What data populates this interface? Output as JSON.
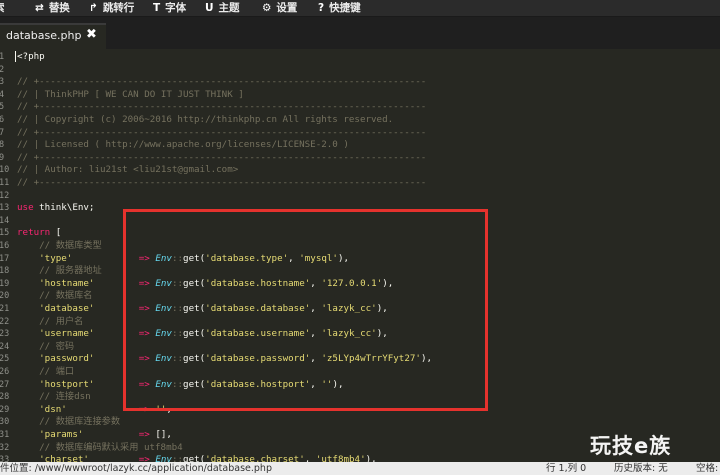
{
  "toolbar": [
    {
      "icon": "search-icon",
      "glyph": "",
      "label": "索"
    },
    {
      "icon": "swap-icon",
      "glyph": "⇄",
      "label": "替换"
    },
    {
      "icon": "goto-line-icon",
      "glyph": "↱",
      "label": "跳转行"
    },
    {
      "icon": "font-icon",
      "glyph": "T",
      "label": "字体"
    },
    {
      "icon": "theme-icon",
      "glyph": "U",
      "label": "主题"
    },
    {
      "icon": "gear-icon",
      "glyph": "⚙",
      "label": "设置"
    },
    {
      "icon": "question-icon",
      "glyph": "?",
      "label": "快捷键"
    }
  ],
  "tab": {
    "label": "database.php",
    "close": "✖"
  },
  "lines": [
    [
      {
        "c": "c-txt",
        "t": "<?php"
      }
    ],
    [],
    [
      {
        "c": "c-cm",
        "t": "// +----------------------------------------------------------------------"
      }
    ],
    [
      {
        "c": "c-cm",
        "t": "// | ThinkPHP [ WE CAN DO IT JUST THINK ]"
      }
    ],
    [
      {
        "c": "c-cm",
        "t": "// +----------------------------------------------------------------------"
      }
    ],
    [
      {
        "c": "c-cm",
        "t": "// | Copyright (c) 2006~2016 http://thinkphp.cn All rights reserved."
      }
    ],
    [
      {
        "c": "c-cm",
        "t": "// +----------------------------------------------------------------------"
      }
    ],
    [
      {
        "c": "c-cm",
        "t": "// | Licensed ( http://www.apache.org/licenses/LICENSE-2.0 )"
      }
    ],
    [
      {
        "c": "c-cm",
        "t": "// +----------------------------------------------------------------------"
      }
    ],
    [
      {
        "c": "c-cm",
        "t": "// | Author: liu21st <liu21st@gmail.com>"
      }
    ],
    [
      {
        "c": "c-cm",
        "t": "// +----------------------------------------------------------------------"
      }
    ],
    [],
    [
      {
        "c": "c-kw",
        "t": "use"
      },
      {
        "c": "c-txt",
        "t": " think\\Env;"
      }
    ],
    [],
    [
      {
        "c": "c-kw",
        "t": "return"
      },
      {
        "c": "c-txt",
        "t": " ["
      }
    ],
    [
      {
        "c": "c-cm",
        "t": "    // 数据库类型"
      }
    ],
    [
      {
        "c": "c-str",
        "t": "    'type'"
      },
      {
        "c": "c-txt",
        "t": "            "
      },
      {
        "c": "c-op",
        "t": "=>"
      },
      {
        "c": "c-txt",
        "t": " "
      },
      {
        "c": "c-cls",
        "t": "Env"
      },
      {
        "c": "c-dim",
        "t": "::"
      },
      {
        "c": "c-txt",
        "t": "get("
      },
      {
        "c": "c-str",
        "t": "'database.type'"
      },
      {
        "c": "c-txt",
        "t": ", "
      },
      {
        "c": "c-str",
        "t": "'mysql'"
      },
      {
        "c": "c-txt",
        "t": "),"
      }
    ],
    [
      {
        "c": "c-cm",
        "t": "    // 服务器地址"
      }
    ],
    [
      {
        "c": "c-str",
        "t": "    'hostname'"
      },
      {
        "c": "c-txt",
        "t": "        "
      },
      {
        "c": "c-op",
        "t": "=>"
      },
      {
        "c": "c-txt",
        "t": " "
      },
      {
        "c": "c-cls",
        "t": "Env"
      },
      {
        "c": "c-dim",
        "t": "::"
      },
      {
        "c": "c-txt",
        "t": "get("
      },
      {
        "c": "c-str",
        "t": "'database.hostname'"
      },
      {
        "c": "c-txt",
        "t": ", "
      },
      {
        "c": "c-str",
        "t": "'127.0.0.1'"
      },
      {
        "c": "c-txt",
        "t": "),"
      }
    ],
    [
      {
        "c": "c-cm",
        "t": "    // 数据库名"
      }
    ],
    [
      {
        "c": "c-str",
        "t": "    'database'"
      },
      {
        "c": "c-txt",
        "t": "        "
      },
      {
        "c": "c-op",
        "t": "=>"
      },
      {
        "c": "c-txt",
        "t": " "
      },
      {
        "c": "c-cls",
        "t": "Env"
      },
      {
        "c": "c-dim",
        "t": "::"
      },
      {
        "c": "c-txt",
        "t": "get("
      },
      {
        "c": "c-str",
        "t": "'database.database'"
      },
      {
        "c": "c-txt",
        "t": ", "
      },
      {
        "c": "c-str",
        "t": "'lazyk_cc'"
      },
      {
        "c": "c-txt",
        "t": "),"
      }
    ],
    [
      {
        "c": "c-cm",
        "t": "    // 用户名"
      }
    ],
    [
      {
        "c": "c-str",
        "t": "    'username'"
      },
      {
        "c": "c-txt",
        "t": "        "
      },
      {
        "c": "c-op",
        "t": "=>"
      },
      {
        "c": "c-txt",
        "t": " "
      },
      {
        "c": "c-cls",
        "t": "Env"
      },
      {
        "c": "c-dim",
        "t": "::"
      },
      {
        "c": "c-txt",
        "t": "get("
      },
      {
        "c": "c-str",
        "t": "'database.username'"
      },
      {
        "c": "c-txt",
        "t": ", "
      },
      {
        "c": "c-str",
        "t": "'lazyk_cc'"
      },
      {
        "c": "c-txt",
        "t": "),"
      }
    ],
    [
      {
        "c": "c-cm",
        "t": "    // 密码"
      }
    ],
    [
      {
        "c": "c-str",
        "t": "    'password'"
      },
      {
        "c": "c-txt",
        "t": "        "
      },
      {
        "c": "c-op",
        "t": "=>"
      },
      {
        "c": "c-txt",
        "t": " "
      },
      {
        "c": "c-cls",
        "t": "Env"
      },
      {
        "c": "c-dim",
        "t": "::"
      },
      {
        "c": "c-txt",
        "t": "get("
      },
      {
        "c": "c-str",
        "t": "'database.password'"
      },
      {
        "c": "c-txt",
        "t": ", "
      },
      {
        "c": "c-str",
        "t": "'z5LYp4wTrrYFyt27'"
      },
      {
        "c": "c-txt",
        "t": "),"
      }
    ],
    [
      {
        "c": "c-cm",
        "t": "    // 端口"
      }
    ],
    [
      {
        "c": "c-str",
        "t": "    'hostport'"
      },
      {
        "c": "c-txt",
        "t": "        "
      },
      {
        "c": "c-op",
        "t": "=>"
      },
      {
        "c": "c-txt",
        "t": " "
      },
      {
        "c": "c-cls",
        "t": "Env"
      },
      {
        "c": "c-dim",
        "t": "::"
      },
      {
        "c": "c-txt",
        "t": "get("
      },
      {
        "c": "c-str",
        "t": "'database.hostport'"
      },
      {
        "c": "c-txt",
        "t": ", "
      },
      {
        "c": "c-str",
        "t": "''"
      },
      {
        "c": "c-txt",
        "t": "),"
      }
    ],
    [
      {
        "c": "c-cm",
        "t": "    // 连接dsn"
      }
    ],
    [
      {
        "c": "c-str",
        "t": "    'dsn'"
      },
      {
        "c": "c-txt",
        "t": "             "
      },
      {
        "c": "c-op",
        "t": "=>"
      },
      {
        "c": "c-txt",
        "t": " "
      },
      {
        "c": "c-str",
        "t": "''"
      },
      {
        "c": "c-txt",
        "t": ","
      }
    ],
    [
      {
        "c": "c-cm",
        "t": "    // 数据库连接参数"
      }
    ],
    [
      {
        "c": "c-str",
        "t": "    'params'"
      },
      {
        "c": "c-txt",
        "t": "          "
      },
      {
        "c": "c-op",
        "t": "=>"
      },
      {
        "c": "c-txt",
        "t": " [],"
      }
    ],
    [
      {
        "c": "c-cm",
        "t": "    // 数据库编码默认采用 utf8mb4"
      }
    ],
    [
      {
        "c": "c-str",
        "t": "    'charset'"
      },
      {
        "c": "c-txt",
        "t": "         "
      },
      {
        "c": "c-op",
        "t": "=>"
      },
      {
        "c": "c-txt",
        "t": " "
      },
      {
        "c": "c-cls",
        "t": "Env"
      },
      {
        "c": "c-dim",
        "t": "::"
      },
      {
        "c": "c-txt",
        "t": "get("
      },
      {
        "c": "c-str",
        "t": "'database.charset'"
      },
      {
        "c": "c-txt",
        "t": ", "
      },
      {
        "c": "c-str",
        "t": "'utf8mb4'"
      },
      {
        "c": "c-txt",
        "t": "),"
      }
    ]
  ],
  "status": {
    "path": "件位置: /www/wwwroot/lazyk.cc/application/database.php",
    "cursor": "行 1,列 0",
    "history": "历史版本: 无",
    "indent": "空格:"
  },
  "watermark": "玩技e族",
  "colors": {
    "background": "#272822",
    "highlight": "#e5322d",
    "keyword": "#f92672",
    "string": "#e6db74",
    "comment": "#75715e",
    "class": "#66d9ef"
  }
}
